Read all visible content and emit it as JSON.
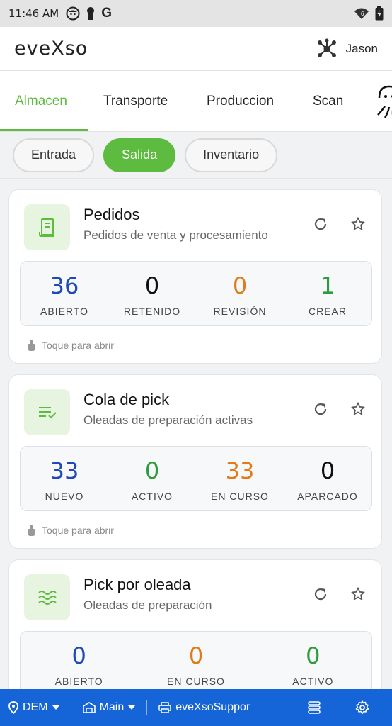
{
  "status_bar": {
    "time": "11:46 AM",
    "icons": [
      "face-icon",
      "keyhole-icon",
      "google-g-icon",
      "wifi-icon",
      "battery-icon"
    ],
    "g_letter": "G",
    "wifi_badge": "6"
  },
  "app_bar": {
    "logo": "eveXso",
    "user_name": "Jason",
    "user_icon": "network-nodes-icon"
  },
  "tabs": [
    {
      "label": "Almacen",
      "active": true
    },
    {
      "label": "Transporte",
      "active": false
    },
    {
      "label": "Produccion",
      "active": false
    },
    {
      "label": "Scan",
      "active": false
    }
  ],
  "chips": [
    {
      "label": "Entrada",
      "active": false
    },
    {
      "label": "Salida",
      "active": true
    },
    {
      "label": "Inventario",
      "active": false
    }
  ],
  "cards": [
    {
      "title": "Pedidos",
      "subtitle": "Pedidos de venta y procesamiento",
      "icon": "receipt-icon",
      "stats": [
        {
          "value": "36",
          "label": "ABIERTO",
          "color": "#1f49b6"
        },
        {
          "value": "0",
          "label": "RETENIDO",
          "color": "#111111"
        },
        {
          "value": "0",
          "label": "REVISIÓN",
          "color": "#e07b1a"
        },
        {
          "value": "1",
          "label": "CREAR",
          "color": "#2e9c3d"
        }
      ],
      "hint": "Toque para abrir"
    },
    {
      "title": "Cola de pick",
      "subtitle": "Oleadas de preparación activas",
      "icon": "list-check-icon",
      "stats": [
        {
          "value": "33",
          "label": "NUEVO",
          "color": "#1f49b6"
        },
        {
          "value": "0",
          "label": "ACTIVO",
          "color": "#2e9c3d"
        },
        {
          "value": "33",
          "label": "EN CURSO",
          "color": "#e07b1a"
        },
        {
          "value": "0",
          "label": "APARCADO",
          "color": "#111111"
        }
      ],
      "hint": "Toque para abrir"
    },
    {
      "title": "Pick por oleada",
      "subtitle": "Oleadas de preparación",
      "icon": "waves-icon",
      "stats": [
        {
          "value": "0",
          "label": "ABIERTO",
          "color": "#1f49b6"
        },
        {
          "value": "0",
          "label": "EN CURSO",
          "color": "#e07b1a"
        },
        {
          "value": "0",
          "label": "ACTIVO",
          "color": "#2e9c3d"
        }
      ]
    }
  ],
  "bottom_bar": {
    "location": "DEM",
    "warehouse": "Main",
    "printer": "eveXsoSuppor",
    "background_color": "#1565d8"
  },
  "accent_color": "#5dbb3f"
}
